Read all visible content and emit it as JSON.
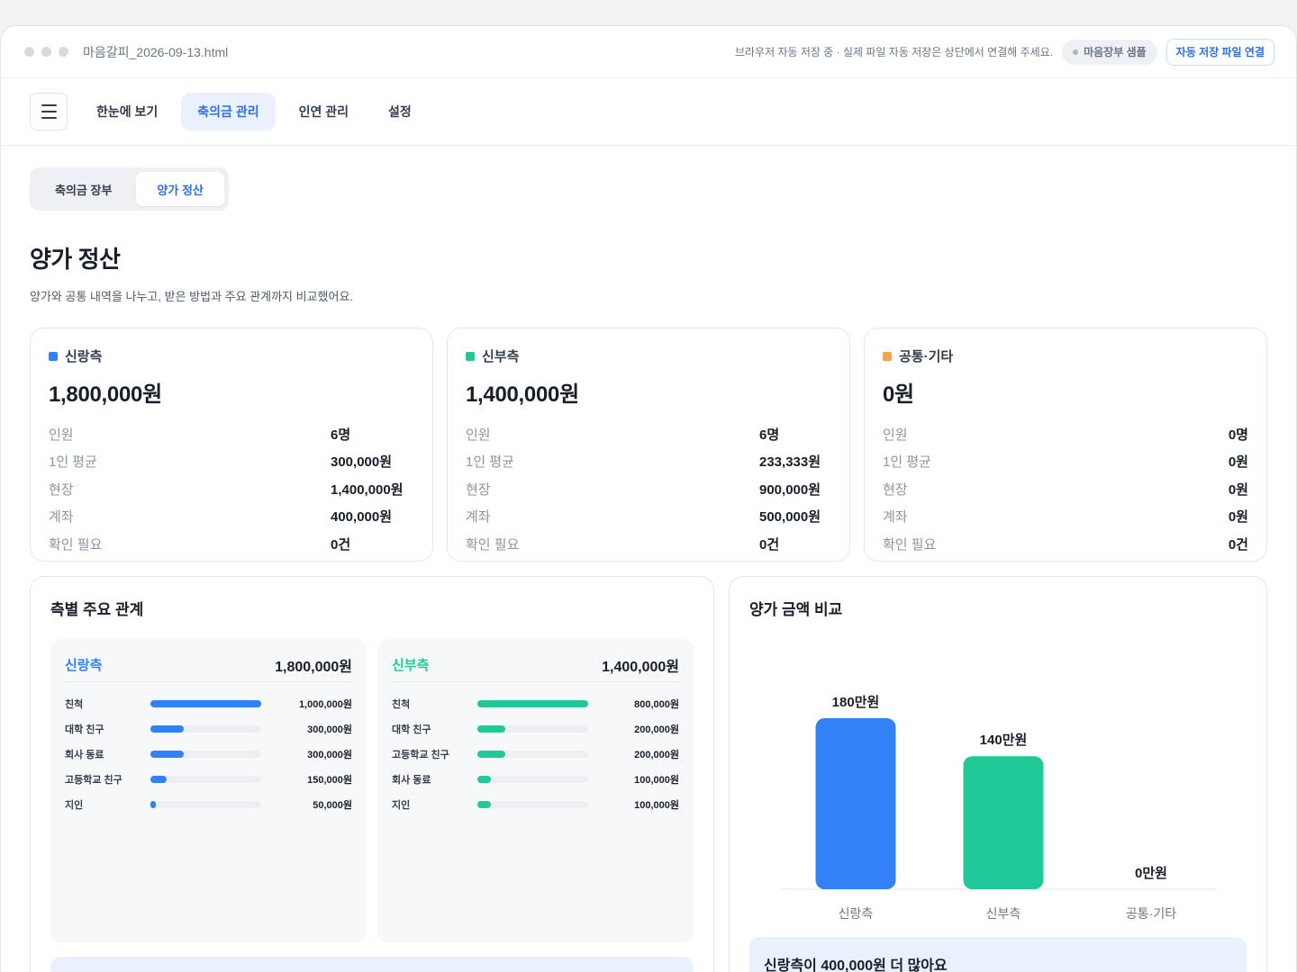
{
  "titlebar": {
    "filename": "마음갈피_2026-09-13.html",
    "autosave_note": "브라우저 자동 저장 중 · 실제 파일 자동 저장은 상단에서 연결해 주세요.",
    "sample_badge": "마음장부 샘플",
    "connect_button": "자동 저장 파일 연결"
  },
  "nav": {
    "tabs": [
      {
        "label": "한눈에 보기",
        "active": false
      },
      {
        "label": "축의금 관리",
        "active": true
      },
      {
        "label": "인연 관리",
        "active": false
      },
      {
        "label": "설정",
        "active": false
      }
    ]
  },
  "subtabs": [
    {
      "label": "축의금 장부",
      "active": false
    },
    {
      "label": "양가 정산",
      "active": true
    }
  ],
  "page": {
    "title": "양가 정산",
    "subtitle": "양가와 공통 내역을 나누고, 받은 방법과 주요 관계까지 비교했어요."
  },
  "summary_labels": {
    "count": "인원",
    "avg": "1인 평균",
    "onsite": "현장",
    "account": "계좌",
    "needs_check": "확인 필요"
  },
  "summary": [
    {
      "name": "신랑측",
      "color": "#3182f6",
      "total": "1,800,000원",
      "count": "6명",
      "avg": "300,000원",
      "onsite": "1,400,000원",
      "account": "400,000원",
      "needs_check": "0건"
    },
    {
      "name": "신부측",
      "color": "#20c997",
      "total": "1,400,000원",
      "count": "6명",
      "avg": "233,333원",
      "onsite": "900,000원",
      "account": "500,000원",
      "needs_check": "0건"
    },
    {
      "name": "공통·기타",
      "color": "#f5a54a",
      "total": "0원",
      "count": "0명",
      "avg": "0원",
      "onsite": "0원",
      "account": "0원",
      "needs_check": "0건"
    }
  ],
  "relations": {
    "title": "측별 주요 관계",
    "columns": [
      {
        "name": "신랑측",
        "color": "#3182f6",
        "total": "1,800,000원",
        "items": [
          {
            "name": "친척",
            "amount": "1,000,000원",
            "ratio": 1.0
          },
          {
            "name": "대학 친구",
            "amount": "300,000원",
            "ratio": 0.3
          },
          {
            "name": "회사 동료",
            "amount": "300,000원",
            "ratio": 0.3
          },
          {
            "name": "고등학교 친구",
            "amount": "150,000원",
            "ratio": 0.15
          },
          {
            "name": "지인",
            "amount": "50,000원",
            "ratio": 0.05
          }
        ]
      },
      {
        "name": "신부측",
        "color": "#20c997",
        "total": "1,400,000원",
        "items": [
          {
            "name": "친척",
            "amount": "800,000원",
            "ratio": 1.0
          },
          {
            "name": "대학 친구",
            "amount": "200,000원",
            "ratio": 0.25
          },
          {
            "name": "고등학교 친구",
            "amount": "200,000원",
            "ratio": 0.25
          },
          {
            "name": "회사 동료",
            "amount": "100,000원",
            "ratio": 0.125
          },
          {
            "name": "지인",
            "amount": "100,000원",
            "ratio": 0.125
          }
        ]
      }
    ]
  },
  "compare": {
    "title": "양가 금액 비교",
    "note": "신랑측이 400,000원 더 많아요"
  },
  "chart_data": {
    "type": "bar",
    "categories": [
      "신랑측",
      "신부측",
      "공통·기타"
    ],
    "values": [
      180,
      140,
      0
    ],
    "value_labels": [
      "180만원",
      "140만원",
      "0만원"
    ],
    "colors": [
      "#3182f6",
      "#20c997",
      "#f5a54a"
    ],
    "ylim": [
      0,
      180
    ],
    "grid": false,
    "title": "",
    "xlabel": "",
    "ylabel": ""
  }
}
